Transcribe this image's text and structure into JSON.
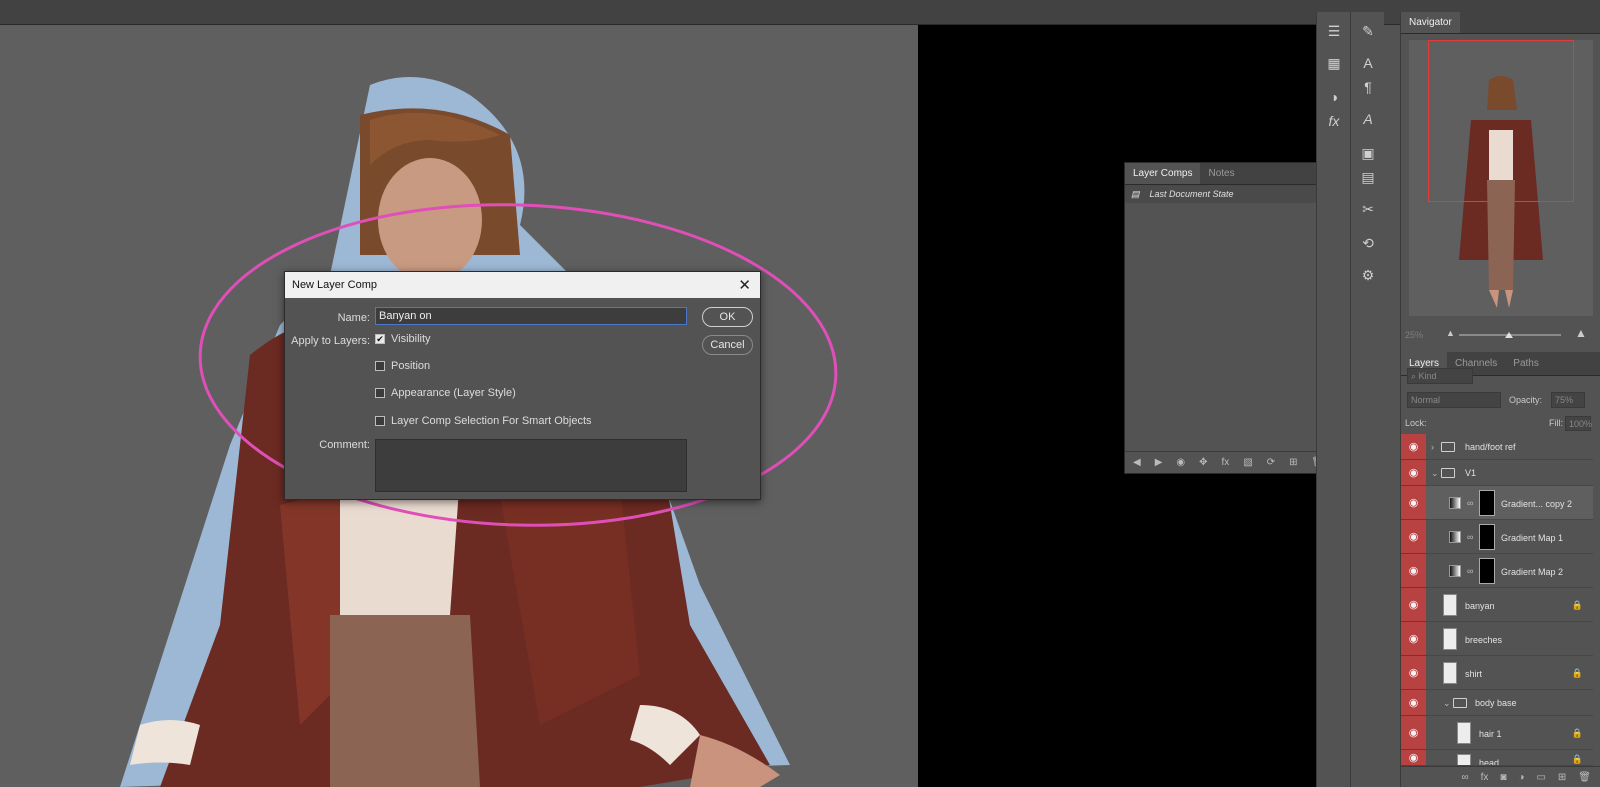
{
  "dialog": {
    "title": "New Layer Comp",
    "name_label": "Name:",
    "name_value": "Banyan on",
    "apply_label": "Apply to Layers:",
    "options": [
      {
        "label": "Visibility",
        "checked": true
      },
      {
        "label": "Position",
        "checked": false
      },
      {
        "label": "Appearance (Layer Style)",
        "checked": false
      },
      {
        "label": "Layer Comp Selection For Smart Objects",
        "checked": false
      }
    ],
    "comment_label": "Comment:",
    "ok_label": "OK",
    "cancel_label": "Cancel"
  },
  "layer_comps_panel": {
    "tabs": [
      "Layer Comps",
      "Notes"
    ],
    "rows": [
      "Last Document State"
    ]
  },
  "navigator": {
    "title": "Navigator",
    "zoom": "25%"
  },
  "layers_panel": {
    "tabs": [
      "Layers",
      "Channels",
      "Paths"
    ],
    "filter_placeholder": "Kind",
    "blend_mode": "Normal",
    "opacity_label": "Opacity:",
    "opacity_value": "75%",
    "lock_label": "Lock:",
    "fill_label": "Fill:",
    "fill_value": "100%",
    "layers": [
      {
        "name": "hand/foot ref",
        "kind": "group",
        "visible": true,
        "collapsed": true
      },
      {
        "name": "V1",
        "kind": "group",
        "visible": true,
        "collapsed": false
      },
      {
        "name": "Gradient... copy 2",
        "kind": "adjustment",
        "visible": true,
        "selected": true
      },
      {
        "name": "Gradient Map 1",
        "kind": "adjustment",
        "visible": true
      },
      {
        "name": "Gradient Map 2",
        "kind": "adjustment",
        "visible": true
      },
      {
        "name": "banyan",
        "kind": "pixel",
        "visible": true,
        "locked": true
      },
      {
        "name": "breeches",
        "kind": "pixel",
        "visible": true
      },
      {
        "name": "shirt",
        "kind": "pixel",
        "visible": true,
        "locked": true
      },
      {
        "name": "body base",
        "kind": "group",
        "visible": true
      },
      {
        "name": "hair 1",
        "kind": "pixel",
        "visible": true,
        "locked": true
      },
      {
        "name": "head",
        "kind": "pixel",
        "visible": true,
        "locked": true
      }
    ]
  }
}
